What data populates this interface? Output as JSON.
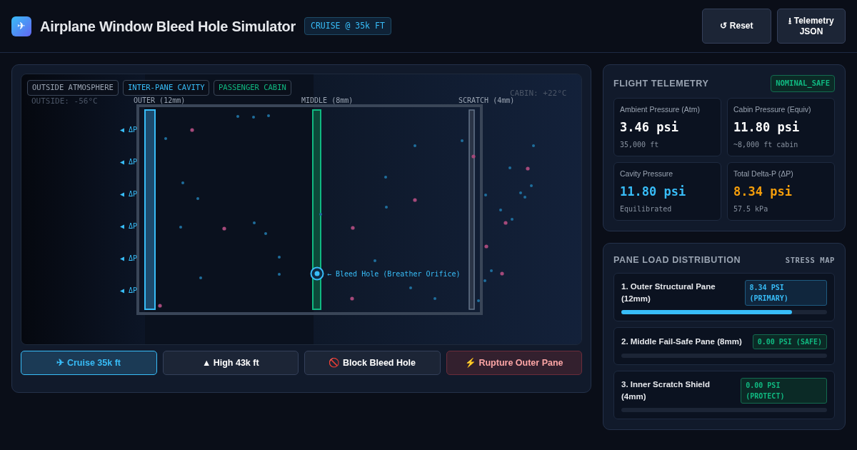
{
  "header": {
    "logo": "✈",
    "title": "Airplane Window Bleed Hole Simulator",
    "mode_badge": "CRUISE @ 35k FT",
    "buttons": [
      {
        "label": "↺ Reset"
      },
      {
        "label": "⭳ Telemetry JSON"
      }
    ]
  },
  "simulator": {
    "zones": [
      {
        "label": "OUTSIDE ATMOSPHERE",
        "color": "#9aa4b2"
      },
      {
        "label": "INTER-PANE CAVITY",
        "color": "#38bdf8"
      },
      {
        "label": "PASSENGER CABIN",
        "color": "#10b981"
      }
    ],
    "outside_temp": "OUTSIDE: -56°C",
    "cabin_temp": "CABIN: +22°C",
    "panes": [
      {
        "label": "OUTER (12mm)",
        "kind": "outer"
      },
      {
        "label": "MIDDLE (8mm)",
        "kind": "middle"
      },
      {
        "label": "SCRATCH (4mm)",
        "kind": "scratch"
      }
    ],
    "pressure_arrows": [
      "◀ ΔP",
      "◀ ΔP",
      "◀ ΔP",
      "◀ ΔP",
      "◀ ΔP",
      "◀ ΔP"
    ],
    "bleed_hole_label": "← Bleed Hole (Breather Orifice)"
  },
  "controls": [
    {
      "label": "✈ Cruise 35k ft",
      "kind": "normal",
      "selected": true
    },
    {
      "label": "▲ High 43k ft",
      "kind": "normal",
      "selected": false
    },
    {
      "label": "🚫 Block Bleed Hole",
      "kind": "normal",
      "selected": false
    },
    {
      "label": "⚡ Rupture Outer Pane",
      "kind": "danger",
      "selected": false
    }
  ],
  "telemetry": {
    "title": "FLIGHT TELEMETRY",
    "status": "NOMINAL_SAFE",
    "cards": [
      {
        "label": "Ambient Pressure (Atm)",
        "value": "3.46 psi",
        "sub": "35,000 ft",
        "kind": "plain"
      },
      {
        "label": "Cabin Pressure (Equiv)",
        "value": "11.80 psi",
        "sub": "~8,000 ft cabin",
        "kind": "plain"
      },
      {
        "label": "Cavity Pressure",
        "value": "11.80 psi",
        "sub": "Equilibrated",
        "kind": "info"
      },
      {
        "label": "Total Delta-P (ΔP)",
        "value": "8.34 psi",
        "sub": "57.5 kPa",
        "kind": "warn"
      }
    ]
  },
  "load": {
    "title": "PANE LOAD DISTRIBUTION",
    "subtitle": "STRESS MAP",
    "panes": [
      {
        "name": "1. Outer Structural Pane (12mm)",
        "reading": "8.34 PSI (PRIMARY)",
        "kind": "primary",
        "level": 0.83
      },
      {
        "name": "2. Middle Fail-Safe Pane (8mm)",
        "reading": "0.00 PSI (SAFE)",
        "kind": "safe",
        "level": 0
      },
      {
        "name": "3. Inner Scratch Shield (4mm)",
        "reading": "0.00 PSI (PROTECT)",
        "kind": "safe",
        "level": 0
      }
    ]
  }
}
